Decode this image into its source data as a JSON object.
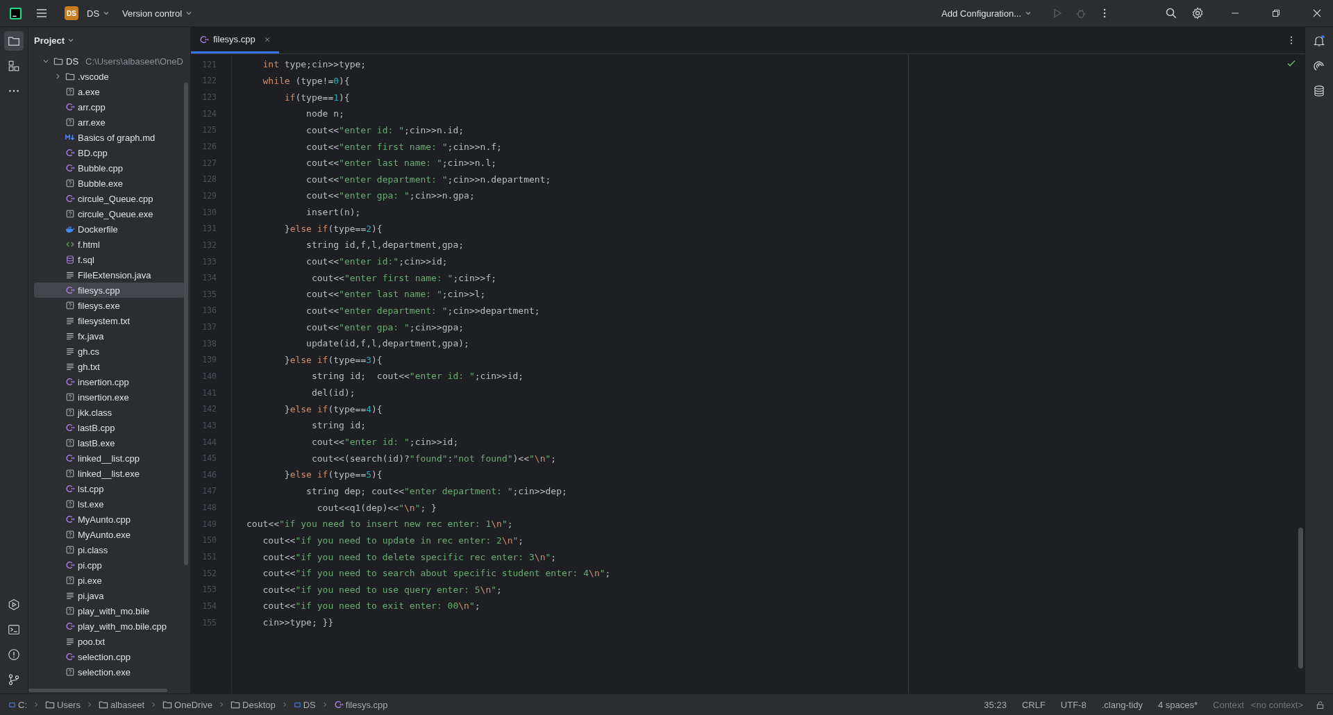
{
  "title_bar": {
    "project_badge": "DS",
    "project_name": "DS",
    "version_control": "Version control",
    "run_config": "Add Configuration..."
  },
  "project_panel": {
    "title": "Project",
    "tree": [
      {
        "name": "DS",
        "path": "C:\\Users\\albaseet\\OneD",
        "kind": "folder",
        "expanded": true,
        "selected": false,
        "children": [
          {
            "name": ".vscode",
            "kind": "folder",
            "expanded": false,
            "selected": false
          },
          {
            "name": "a.exe",
            "kind": "unknown",
            "selected": false
          },
          {
            "name": "arr.cpp",
            "kind": "cpp",
            "selected": false
          },
          {
            "name": "arr.exe",
            "kind": "unknown",
            "selected": false
          },
          {
            "name": "Basics of graph.md",
            "kind": "markdown",
            "selected": false
          },
          {
            "name": "BD.cpp",
            "kind": "cpp",
            "selected": false
          },
          {
            "name": "Bubble.cpp",
            "kind": "cpp",
            "selected": false
          },
          {
            "name": "Bubble.exe",
            "kind": "unknown",
            "selected": false
          },
          {
            "name": "circule_Queue.cpp",
            "kind": "cpp",
            "selected": false
          },
          {
            "name": "circule_Queue.exe",
            "kind": "unknown",
            "selected": false
          },
          {
            "name": "Dockerfile",
            "kind": "docker",
            "selected": false
          },
          {
            "name": "f.html",
            "kind": "html",
            "selected": false
          },
          {
            "name": "f.sql",
            "kind": "sql",
            "selected": false
          },
          {
            "name": "FileExtension.java",
            "kind": "text",
            "selected": false
          },
          {
            "name": "filesys.cpp",
            "kind": "cpp",
            "selected": true
          },
          {
            "name": "filesys.exe",
            "kind": "unknown",
            "selected": false
          },
          {
            "name": "filesystem.txt",
            "kind": "text",
            "selected": false
          },
          {
            "name": "fx.java",
            "kind": "text",
            "selected": false
          },
          {
            "name": "gh.cs",
            "kind": "text",
            "selected": false
          },
          {
            "name": "gh.txt",
            "kind": "text",
            "selected": false
          },
          {
            "name": "insertion.cpp",
            "kind": "cpp",
            "selected": false
          },
          {
            "name": "insertion.exe",
            "kind": "unknown",
            "selected": false
          },
          {
            "name": "jkk.class",
            "kind": "unknown",
            "selected": false
          },
          {
            "name": "lastB.cpp",
            "kind": "cpp",
            "selected": false
          },
          {
            "name": "lastB.exe",
            "kind": "unknown",
            "selected": false
          },
          {
            "name": "linked__list.cpp",
            "kind": "cpp",
            "selected": false
          },
          {
            "name": "linked__list.exe",
            "kind": "unknown",
            "selected": false
          },
          {
            "name": "lst.cpp",
            "kind": "cpp",
            "selected": false
          },
          {
            "name": "lst.exe",
            "kind": "unknown",
            "selected": false
          },
          {
            "name": "MyAunto.cpp",
            "kind": "cpp",
            "selected": false
          },
          {
            "name": "MyAunto.exe",
            "kind": "unknown",
            "selected": false
          },
          {
            "name": "pi.class",
            "kind": "unknown",
            "selected": false
          },
          {
            "name": "pi.cpp",
            "kind": "cpp",
            "selected": false
          },
          {
            "name": "pi.exe",
            "kind": "unknown",
            "selected": false
          },
          {
            "name": "pi.java",
            "kind": "text",
            "selected": false
          },
          {
            "name": "play_with_mo.bile",
            "kind": "unknown",
            "selected": false
          },
          {
            "name": "play_with_mo.bile.cpp",
            "kind": "cpp",
            "selected": false
          },
          {
            "name": "poo.txt",
            "kind": "text",
            "selected": false
          },
          {
            "name": "selection.cpp",
            "kind": "cpp",
            "selected": false
          },
          {
            "name": "selection.exe",
            "kind": "unknown",
            "selected": false
          }
        ]
      }
    ]
  },
  "editor": {
    "tabs": [
      {
        "label": "filesys.cpp",
        "kind": "cpp",
        "selected": true
      }
    ],
    "lines": [
      {
        "number": "121",
        "tokens": [
          {
            "kind": "keyword",
            "text": "   int"
          },
          {
            "kind": "plain",
            "text": " type;cin>>type;"
          }
        ]
      },
      {
        "number": "122",
        "tokens": [
          {
            "kind": "keyword",
            "text": "   while"
          },
          {
            "kind": "plain",
            "text": " (type!="
          },
          {
            "kind": "number",
            "text": "0"
          },
          {
            "kind": "plain",
            "text": "){"
          }
        ]
      },
      {
        "number": "123",
        "tokens": [
          {
            "kind": "keyword",
            "text": "       if"
          },
          {
            "kind": "plain",
            "text": "(type=="
          },
          {
            "kind": "number",
            "text": "1"
          },
          {
            "kind": "plain",
            "text": "){"
          }
        ]
      },
      {
        "number": "124",
        "tokens": [
          {
            "kind": "plain",
            "text": "           node n;"
          }
        ]
      },
      {
        "number": "125",
        "tokens": [
          {
            "kind": "plain",
            "text": "           cout<<"
          },
          {
            "kind": "string",
            "text": "\"enter id: \""
          },
          {
            "kind": "plain",
            "text": ";cin>>n.id;"
          }
        ]
      },
      {
        "number": "126",
        "tokens": [
          {
            "kind": "plain",
            "text": "           cout<<"
          },
          {
            "kind": "string",
            "text": "\"enter first name: \""
          },
          {
            "kind": "plain",
            "text": ";cin>>n.f;"
          }
        ]
      },
      {
        "number": "127",
        "tokens": [
          {
            "kind": "plain",
            "text": "           cout<<"
          },
          {
            "kind": "string",
            "text": "\"enter last name: \""
          },
          {
            "kind": "plain",
            "text": ";cin>>n.l;"
          }
        ]
      },
      {
        "number": "128",
        "tokens": [
          {
            "kind": "plain",
            "text": "           cout<<"
          },
          {
            "kind": "string",
            "text": "\"enter department: \""
          },
          {
            "kind": "plain",
            "text": ";cin>>n.department;"
          }
        ]
      },
      {
        "number": "129",
        "tokens": [
          {
            "kind": "plain",
            "text": "           cout<<"
          },
          {
            "kind": "string",
            "text": "\"enter gpa: \""
          },
          {
            "kind": "plain",
            "text": ";cin>>n.gpa;"
          }
        ]
      },
      {
        "number": "130",
        "tokens": [
          {
            "kind": "plain",
            "text": "           insert(n);"
          }
        ]
      },
      {
        "number": "131",
        "tokens": [
          {
            "kind": "plain",
            "text": "       }"
          },
          {
            "kind": "keyword",
            "text": "else if"
          },
          {
            "kind": "plain",
            "text": "(type=="
          },
          {
            "kind": "number",
            "text": "2"
          },
          {
            "kind": "plain",
            "text": "){"
          }
        ]
      },
      {
        "number": "132",
        "tokens": [
          {
            "kind": "plain",
            "text": "           string id,f,l,department,gpa;"
          }
        ]
      },
      {
        "number": "133",
        "tokens": [
          {
            "kind": "plain",
            "text": "           cout<<"
          },
          {
            "kind": "string",
            "text": "\"enter id:\""
          },
          {
            "kind": "plain",
            "text": ";cin>>id;"
          }
        ]
      },
      {
        "number": "134",
        "tokens": [
          {
            "kind": "plain",
            "text": "            cout<<"
          },
          {
            "kind": "string",
            "text": "\"enter first name: \""
          },
          {
            "kind": "plain",
            "text": ";cin>>f;"
          }
        ]
      },
      {
        "number": "135",
        "tokens": [
          {
            "kind": "plain",
            "text": "           cout<<"
          },
          {
            "kind": "string",
            "text": "\"enter last name: \""
          },
          {
            "kind": "plain",
            "text": ";cin>>l;"
          }
        ]
      },
      {
        "number": "136",
        "tokens": [
          {
            "kind": "plain",
            "text": "           cout<<"
          },
          {
            "kind": "string",
            "text": "\"enter department: \""
          },
          {
            "kind": "plain",
            "text": ";cin>>department;"
          }
        ]
      },
      {
        "number": "137",
        "tokens": [
          {
            "kind": "plain",
            "text": "           cout<<"
          },
          {
            "kind": "string",
            "text": "\"enter gpa: \""
          },
          {
            "kind": "plain",
            "text": ";cin>>gpa;"
          }
        ]
      },
      {
        "number": "138",
        "tokens": [
          {
            "kind": "plain",
            "text": "           update(id,f,l,department,gpa);"
          }
        ]
      },
      {
        "number": "139",
        "tokens": [
          {
            "kind": "plain",
            "text": "       }"
          },
          {
            "kind": "keyword",
            "text": "else if"
          },
          {
            "kind": "plain",
            "text": "(type=="
          },
          {
            "kind": "number",
            "text": "3"
          },
          {
            "kind": "plain",
            "text": "){"
          }
        ]
      },
      {
        "number": "140",
        "tokens": [
          {
            "kind": "plain",
            "text": "            string id;  cout<<"
          },
          {
            "kind": "string",
            "text": "\"enter id: \""
          },
          {
            "kind": "plain",
            "text": ";cin>>id;"
          }
        ]
      },
      {
        "number": "141",
        "tokens": [
          {
            "kind": "plain",
            "text": "            del(id);"
          }
        ]
      },
      {
        "number": "142",
        "tokens": [
          {
            "kind": "plain",
            "text": "       }"
          },
          {
            "kind": "keyword",
            "text": "else if"
          },
          {
            "kind": "plain",
            "text": "(type=="
          },
          {
            "kind": "number",
            "text": "4"
          },
          {
            "kind": "plain",
            "text": "){"
          }
        ]
      },
      {
        "number": "143",
        "tokens": [
          {
            "kind": "plain",
            "text": "            string id;"
          }
        ]
      },
      {
        "number": "144",
        "tokens": [
          {
            "kind": "plain",
            "text": "            cout<<"
          },
          {
            "kind": "string",
            "text": "\"enter id: \""
          },
          {
            "kind": "plain",
            "text": ";cin>>id;"
          }
        ]
      },
      {
        "number": "145",
        "tokens": [
          {
            "kind": "plain",
            "text": "            cout<<(search(id)?"
          },
          {
            "kind": "string",
            "text": "\"found\""
          },
          {
            "kind": "plain",
            "text": ":"
          },
          {
            "kind": "string",
            "text": "\"not found\""
          },
          {
            "kind": "plain",
            "text": ")<<"
          },
          {
            "kind": "string",
            "text": "\""
          },
          {
            "kind": "escape",
            "text": "\\n"
          },
          {
            "kind": "string",
            "text": "\""
          },
          {
            "kind": "plain",
            "text": ";"
          }
        ]
      },
      {
        "number": "146",
        "tokens": [
          {
            "kind": "plain",
            "text": "       }"
          },
          {
            "kind": "keyword",
            "text": "else if"
          },
          {
            "kind": "plain",
            "text": "(type=="
          },
          {
            "kind": "number",
            "text": "5"
          },
          {
            "kind": "plain",
            "text": "){"
          }
        ]
      },
      {
        "number": "147",
        "tokens": [
          {
            "kind": "plain",
            "text": "           string dep; cout<<"
          },
          {
            "kind": "string",
            "text": "\"enter department: \""
          },
          {
            "kind": "plain",
            "text": ";cin>>dep;"
          }
        ]
      },
      {
        "number": "148",
        "tokens": [
          {
            "kind": "plain",
            "text": "             cout<<q1(dep)<<"
          },
          {
            "kind": "string",
            "text": "\""
          },
          {
            "kind": "escape",
            "text": "\\n"
          },
          {
            "kind": "string",
            "text": "\""
          },
          {
            "kind": "plain",
            "text": "; }"
          }
        ]
      },
      {
        "number": "149",
        "tokens": [
          {
            "kind": "plain",
            "text": "cout<<"
          },
          {
            "kind": "string",
            "text": "\"if you need to insert new rec enter: 1"
          },
          {
            "kind": "escape",
            "text": "\\n"
          },
          {
            "kind": "string",
            "text": "\""
          },
          {
            "kind": "plain",
            "text": ";"
          }
        ]
      },
      {
        "number": "150",
        "tokens": [
          {
            "kind": "plain",
            "text": "   cout<<"
          },
          {
            "kind": "string",
            "text": "\"if you need to update in rec enter: 2"
          },
          {
            "kind": "escape",
            "text": "\\n"
          },
          {
            "kind": "string",
            "text": "\""
          },
          {
            "kind": "plain",
            "text": ";"
          }
        ]
      },
      {
        "number": "151",
        "tokens": [
          {
            "kind": "plain",
            "text": "   cout<<"
          },
          {
            "kind": "string",
            "text": "\"if you need to delete specific rec enter: 3"
          },
          {
            "kind": "escape",
            "text": "\\n"
          },
          {
            "kind": "string",
            "text": "\""
          },
          {
            "kind": "plain",
            "text": ";"
          }
        ]
      },
      {
        "number": "152",
        "tokens": [
          {
            "kind": "plain",
            "text": "   cout<<"
          },
          {
            "kind": "string",
            "text": "\"if you need to search about specific student enter: 4"
          },
          {
            "kind": "escape",
            "text": "\\n"
          },
          {
            "kind": "string",
            "text": "\""
          },
          {
            "kind": "plain",
            "text": ";"
          }
        ]
      },
      {
        "number": "153",
        "tokens": [
          {
            "kind": "plain",
            "text": "   cout<<"
          },
          {
            "kind": "string",
            "text": "\"if you need to use query enter: 5"
          },
          {
            "kind": "escape",
            "text": "\\n"
          },
          {
            "kind": "string",
            "text": "\""
          },
          {
            "kind": "plain",
            "text": ";"
          }
        ]
      },
      {
        "number": "154",
        "tokens": [
          {
            "kind": "plain",
            "text": "   cout<<"
          },
          {
            "kind": "string",
            "text": "\"if you need to exit enter: 00"
          },
          {
            "kind": "escape",
            "text": "\\n"
          },
          {
            "kind": "string",
            "text": "\""
          },
          {
            "kind": "plain",
            "text": ";"
          }
        ]
      },
      {
        "number": "155",
        "tokens": [
          {
            "kind": "plain",
            "text": "   cin>>type; }}"
          }
        ]
      }
    ]
  },
  "status_bar": {
    "breadcrumb": [
      {
        "text": "C:",
        "kind": "drive"
      },
      {
        "text": "Users",
        "kind": "folder"
      },
      {
        "text": "albaseet",
        "kind": "folder"
      },
      {
        "text": "OneDrive",
        "kind": "folder"
      },
      {
        "text": "Desktop",
        "kind": "folder"
      },
      {
        "text": "DS",
        "kind": "module"
      },
      {
        "text": "filesys.cpp",
        "kind": "cpp"
      }
    ],
    "position": "35:23",
    "line_separator": "CRLF",
    "encoding": "UTF-8",
    "inspection": ".clang-tidy",
    "indent": "4 spaces*",
    "context_label": "Context",
    "context_value": "<no context>"
  }
}
